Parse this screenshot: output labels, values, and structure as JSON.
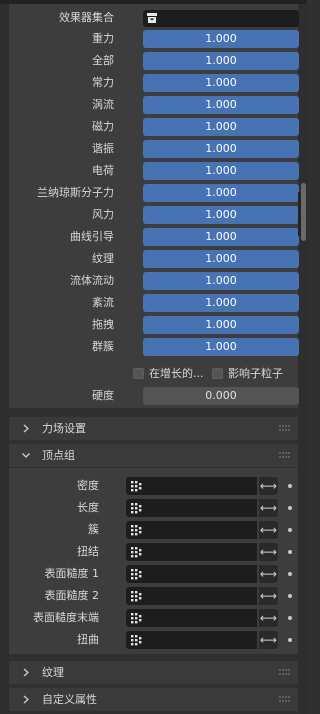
{
  "effector_collection": {
    "label": "效果器集合"
  },
  "weights": [
    {
      "label": "重力",
      "value": "1.000"
    },
    {
      "label": "全部",
      "value": "1.000"
    },
    {
      "label": "常力",
      "value": "1.000"
    },
    {
      "label": "涡流",
      "value": "1.000"
    },
    {
      "label": "磁力",
      "value": "1.000"
    },
    {
      "label": "谐振",
      "value": "1.000"
    },
    {
      "label": "电荷",
      "value": "1.000"
    },
    {
      "label": "兰纳琼斯分子力",
      "value": "1.000"
    },
    {
      "label": "风力",
      "value": "1.000"
    },
    {
      "label": "曲线引导",
      "value": "1.000"
    },
    {
      "label": "纹理",
      "value": "1.000"
    },
    {
      "label": "流体流动",
      "value": "1.000"
    },
    {
      "label": "紊流",
      "value": "1.000"
    },
    {
      "label": "拖拽",
      "value": "1.000"
    },
    {
      "label": "群簇",
      "value": "1.000"
    }
  ],
  "options": {
    "in_growth_label": "在增长的...",
    "affect_children_label": "影响子粒子"
  },
  "stiffness": {
    "label": "硬度",
    "value": "0.000"
  },
  "panels": {
    "force_field_settings": "力场设置",
    "vertex_groups": "顶点组",
    "texture": "纹理",
    "custom_properties": "自定义属性"
  },
  "vertex_group_rows": [
    {
      "label": "密度"
    },
    {
      "label": "长度"
    },
    {
      "label": "簇"
    },
    {
      "label": "扭结"
    },
    {
      "label": "表面糙度 1"
    },
    {
      "label": "表面糙度 2"
    },
    {
      "label": "表面糙度末端"
    },
    {
      "label": "扭曲"
    }
  ],
  "colors": {
    "accent": "#4772b3",
    "panel": "#3d3d3d",
    "field": "#1d1d1d"
  },
  "icons": {
    "collection": "collection-icon",
    "vertex_group": "vertex-group-icon",
    "swap": "swap-arrows-icon",
    "grip": "grip-dots-icon",
    "chevron_right": "chevron-right-icon",
    "chevron_down": "chevron-down-icon"
  }
}
